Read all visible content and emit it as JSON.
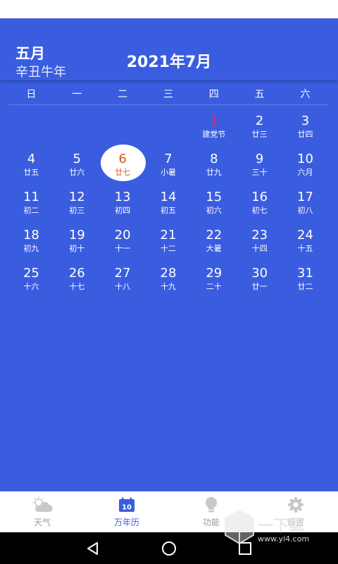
{
  "header": {
    "lunar_month": "五月",
    "ganzhi_year": "辛丑牛年",
    "title": "2021年7月"
  },
  "weekdays": [
    "日",
    "一",
    "二",
    "三",
    "四",
    "五",
    "六"
  ],
  "calendar": {
    "leading_blank_days": 4,
    "today": 6,
    "days": [
      {
        "day": "1",
        "lunar": "建党节",
        "holiday": true
      },
      {
        "day": "2",
        "lunar": "廿三"
      },
      {
        "day": "3",
        "lunar": "廿四"
      },
      {
        "day": "4",
        "lunar": "廿五"
      },
      {
        "day": "5",
        "lunar": "廿六"
      },
      {
        "day": "6",
        "lunar": "廿七",
        "today": true
      },
      {
        "day": "7",
        "lunar": "小暑"
      },
      {
        "day": "8",
        "lunar": "廿九"
      },
      {
        "day": "9",
        "lunar": "三十"
      },
      {
        "day": "10",
        "lunar": "六月"
      },
      {
        "day": "11",
        "lunar": "初二"
      },
      {
        "day": "12",
        "lunar": "初三"
      },
      {
        "day": "13",
        "lunar": "初四"
      },
      {
        "day": "14",
        "lunar": "初五"
      },
      {
        "day": "15",
        "lunar": "初六"
      },
      {
        "day": "16",
        "lunar": "初七"
      },
      {
        "day": "17",
        "lunar": "初八"
      },
      {
        "day": "18",
        "lunar": "初九"
      },
      {
        "day": "19",
        "lunar": "初十"
      },
      {
        "day": "20",
        "lunar": "十一"
      },
      {
        "day": "21",
        "lunar": "十二"
      },
      {
        "day": "22",
        "lunar": "大暑"
      },
      {
        "day": "23",
        "lunar": "十四"
      },
      {
        "day": "24",
        "lunar": "十五"
      },
      {
        "day": "25",
        "lunar": "十六"
      },
      {
        "day": "26",
        "lunar": "十七"
      },
      {
        "day": "27",
        "lunar": "十八"
      },
      {
        "day": "28",
        "lunar": "十九"
      },
      {
        "day": "29",
        "lunar": "二十"
      },
      {
        "day": "30",
        "lunar": "廿一"
      },
      {
        "day": "31",
        "lunar": "廿二"
      }
    ]
  },
  "nav": {
    "items": [
      {
        "label": "天气",
        "icon": "weather-cloud-sun-icon",
        "active": false
      },
      {
        "label": "万年历",
        "icon": "calendar-icon",
        "active": true,
        "icon_text": "10"
      },
      {
        "label": "功能",
        "icon": "lightbulb-icon",
        "active": false
      },
      {
        "label": "设置",
        "icon": "gear-icon",
        "active": false
      }
    ]
  },
  "colors": {
    "background": "#3a5de0",
    "holiday": "#d8298a",
    "today_text": "#d25a12",
    "nav_active": "#3a5de0",
    "nav_inactive": "#9a9a9a"
  },
  "watermark": {
    "text": "一下载",
    "url": "www.yi4.com"
  }
}
